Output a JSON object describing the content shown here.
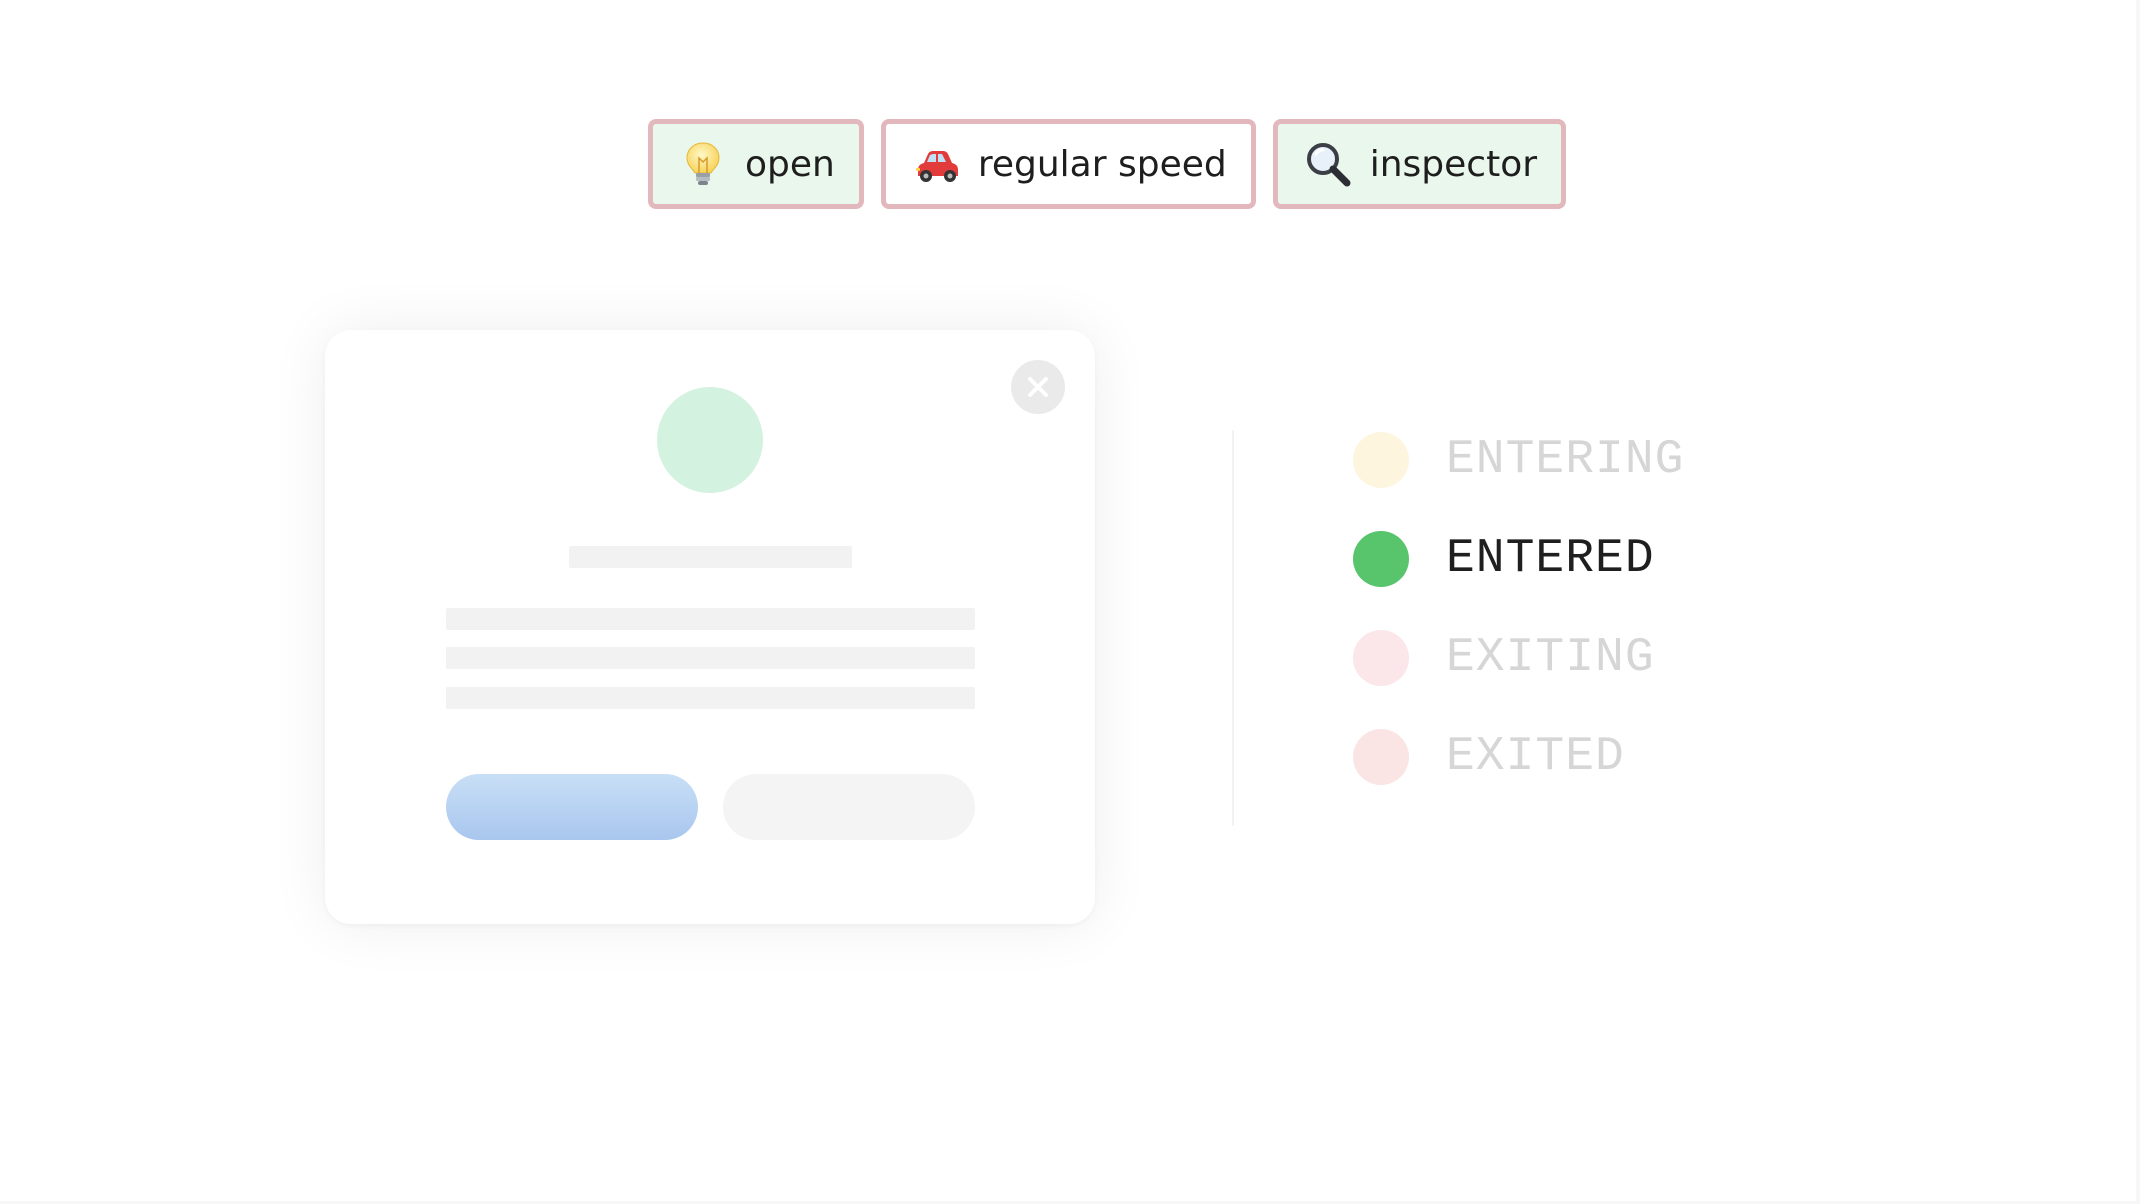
{
  "toolbar": {
    "chips": [
      {
        "label": "open",
        "icon": "lightbulb-icon",
        "active": true
      },
      {
        "label": "regular speed",
        "icon": "car-icon",
        "active": false
      },
      {
        "label": "inspector",
        "icon": "magnifier-icon",
        "active": true
      }
    ]
  },
  "modal": {
    "close_icon": "close-icon",
    "avatar_color": "#d3f2e0",
    "primary_button_color": "#b6d1f2",
    "secondary_button_color": "#f4f4f4"
  },
  "states": {
    "items": [
      {
        "label": "ENTERING",
        "color": "#fdf5de",
        "active": false
      },
      {
        "label": "ENTERED",
        "color": "#58c46c",
        "active": true
      },
      {
        "label": "EXITING",
        "color": "#fbe6ea",
        "active": false
      },
      {
        "label": "EXITED",
        "color": "#fbe4e4",
        "active": false
      }
    ]
  },
  "colors": {
    "chip_border": "#e2b8bc",
    "chip_active_bg": "#e9f7ec",
    "inactive_text": "#d6d6d6",
    "active_text": "#1f1f1f"
  }
}
